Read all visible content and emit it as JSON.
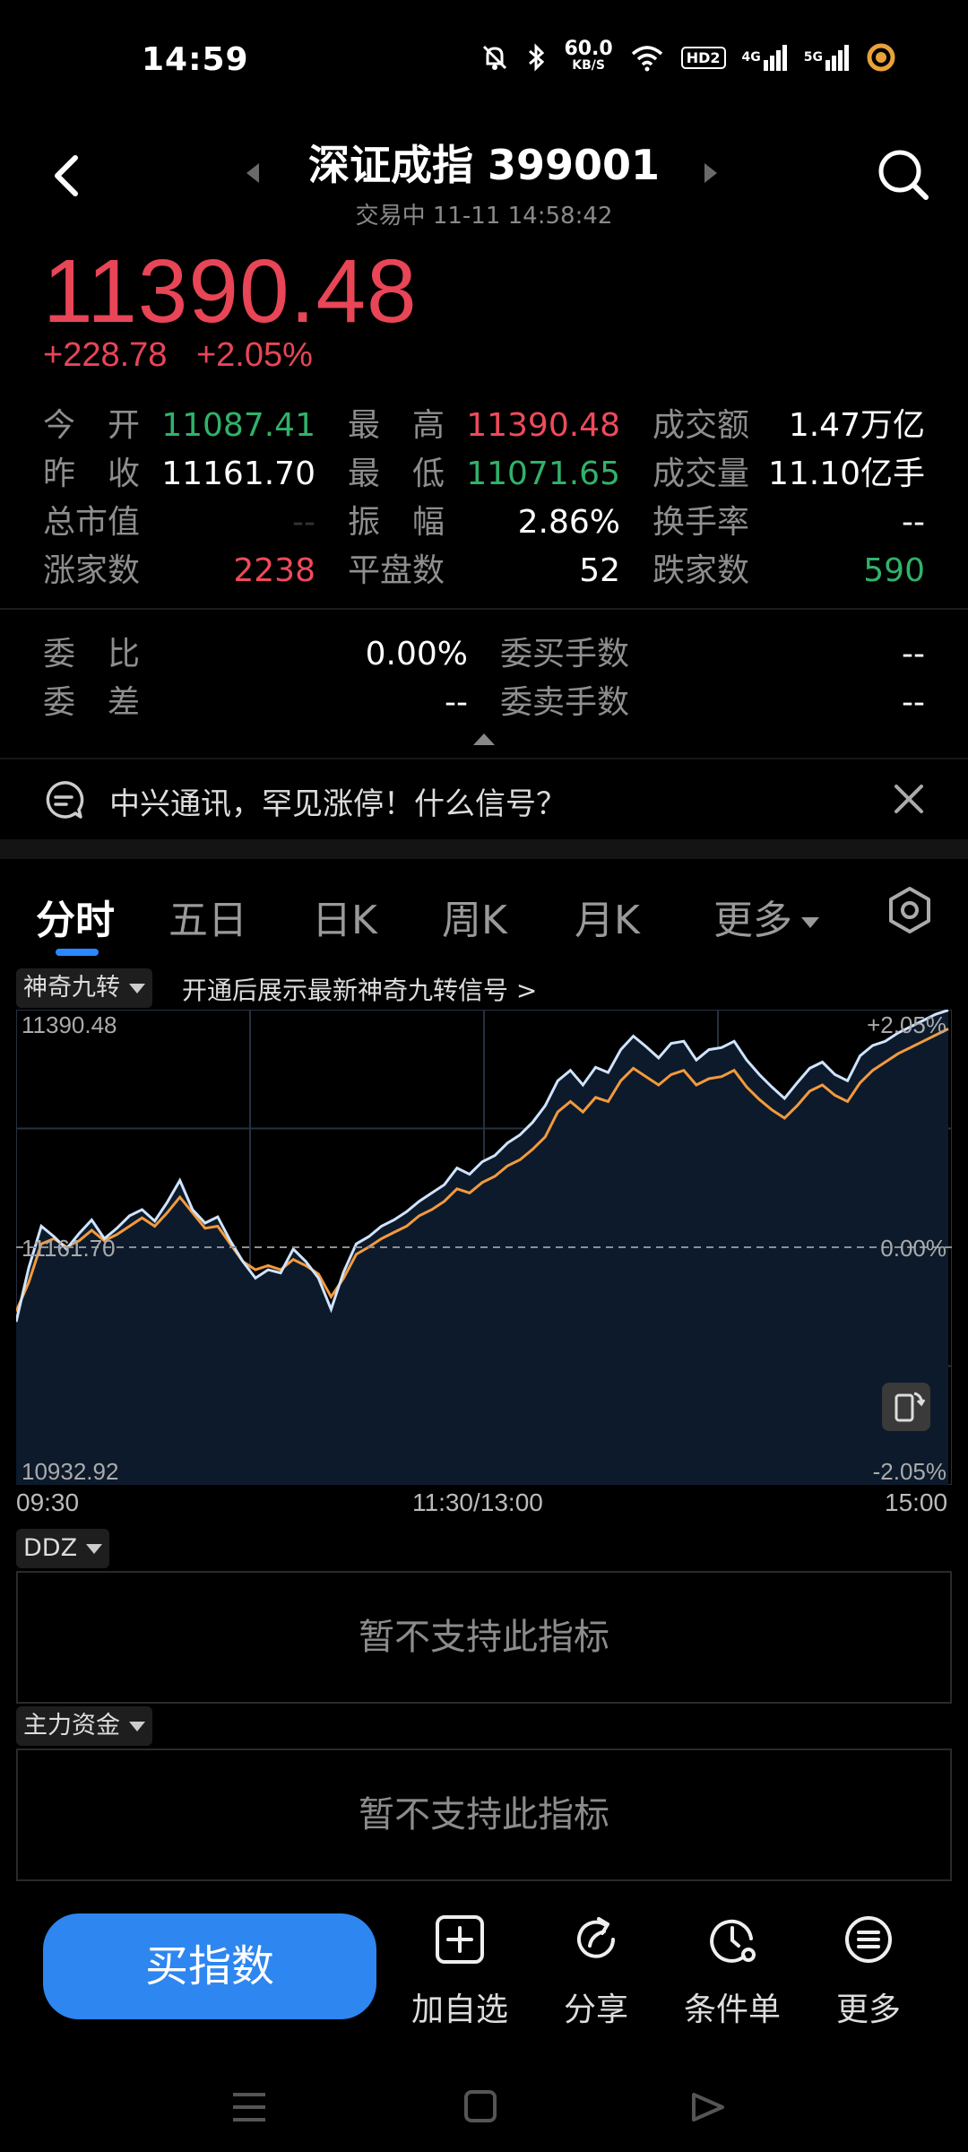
{
  "status_bar": {
    "time": "14:59",
    "net_speed_value": "60.0",
    "net_speed_unit": "KB/S",
    "hd_badge": "HD2",
    "sig1_label": "4G",
    "sig2_label": "5G",
    "icons": [
      "mute-icon",
      "bluetooth-icon",
      "wifi-icon",
      "signal-icon",
      "battery-icon"
    ]
  },
  "header": {
    "title": "深证成指 399001",
    "subtitle": "交易中 11-11 14:58:42"
  },
  "quote": {
    "price": "11390.48",
    "change": "+228.78",
    "change_pct": "+2.05%"
  },
  "stats": {
    "open_label": "今　开",
    "open_value": "11087.41",
    "high_label": "最　高",
    "high_value": "11390.48",
    "amount_label": "成交额",
    "amount_value": "1.47万亿",
    "prev_close_label": "昨　收",
    "prev_close_value": "11161.70",
    "low_label": "最　低",
    "low_value": "11071.65",
    "volume_label": "成交量",
    "volume_value": "11.10亿手",
    "market_cap_label": "总市值",
    "market_cap_value": "--",
    "amplitude_label": "振　幅",
    "amplitude_value": "2.86%",
    "turnover_label": "换手率",
    "turnover_value": "--",
    "up_label": "涨家数",
    "up_value": "2238",
    "flat_label": "平盘数",
    "flat_value": "52",
    "down_label": "跌家数",
    "down_value": "590",
    "commit_ratio_label": "委　比",
    "commit_ratio_value": "0.00%",
    "commit_buy_label": "委买手数",
    "commit_buy_value": "--",
    "commit_diff_label": "委　差",
    "commit_diff_value": "--",
    "commit_sell_label": "委卖手数",
    "commit_sell_value": "--"
  },
  "news": {
    "text": "中兴通讯，罕见涨停！什么信号？"
  },
  "tabs": [
    {
      "label": "分时"
    },
    {
      "label": "五日"
    },
    {
      "label": "日K"
    },
    {
      "label": "周K"
    },
    {
      "label": "月K"
    },
    {
      "label": "更多"
    }
  ],
  "indicator": {
    "chip": "神奇九转",
    "hint": "开通后展示最新神奇九转信号 >"
  },
  "chart_data": {
    "type": "line",
    "y_top_label": "11390.48",
    "y_mid_label": "11161.70",
    "y_bottom_label": "10932.92",
    "pct_top_label": "+2.05%",
    "pct_mid_label": "0.00%",
    "pct_bottom_label": "-2.05%",
    "x_labels": [
      "09:30",
      "11:30/13:00",
      "15:00"
    ],
    "ylim": [
      10932.92,
      11390.48
    ],
    "prev_close": 11161.7,
    "colors": {
      "price": "#cfe4ff",
      "avg": "#f39a3c",
      "fill": "#0d1a2b",
      "grid": "#26313f"
    },
    "series": [
      {
        "values": [
          11090,
          11142,
          11182,
          11172,
          11160,
          11175,
          11188,
          11170,
          11180,
          11192,
          11198,
          11187,
          11205,
          11226,
          11198,
          11185,
          11191,
          11168,
          11148,
          11132,
          11140,
          11137,
          11160,
          11148,
          11132,
          11102,
          11138,
          11165,
          11172,
          11182,
          11188,
          11196,
          11206,
          11214,
          11222,
          11238,
          11232,
          11244,
          11250,
          11262,
          11270,
          11282,
          11298,
          11322,
          11332,
          11318,
          11335,
          11330,
          11352,
          11365,
          11355,
          11344,
          11358,
          11360,
          11342,
          11352,
          11354,
          11360,
          11342,
          11328,
          11316,
          11305,
          11320,
          11334,
          11340,
          11328,
          11322,
          11346,
          11356,
          11360,
          11368,
          11374,
          11380,
          11386,
          11390
        ]
      },
      {
        "values": [
          11100,
          11128,
          11165,
          11170,
          11162,
          11168,
          11178,
          11168,
          11174,
          11182,
          11190,
          11182,
          11195,
          11210,
          11195,
          11180,
          11182,
          11165,
          11148,
          11140,
          11144,
          11140,
          11150,
          11144,
          11136,
          11114,
          11132,
          11155,
          11162,
          11170,
          11176,
          11182,
          11192,
          11198,
          11206,
          11218,
          11214,
          11224,
          11230,
          11240,
          11246,
          11256,
          11268,
          11292,
          11302,
          11292,
          11306,
          11302,
          11322,
          11334,
          11326,
          11318,
          11328,
          11332,
          11318,
          11324,
          11326,
          11332,
          11316,
          11304,
          11294,
          11286,
          11298,
          11312,
          11318,
          11308,
          11302,
          11320,
          11332,
          11340,
          11348,
          11354,
          11360,
          11366,
          11372
        ]
      }
    ]
  },
  "ddz": {
    "chip": "DDZ",
    "message": "暂不支持此指标"
  },
  "main_funds": {
    "chip": "主力资金",
    "message": "暂不支持此指标"
  },
  "bottom_bar": {
    "buy_label": "买指数",
    "add_watch_label": "加自选",
    "share_label": "分享",
    "condition_label": "条件单",
    "more_label": "更多"
  }
}
